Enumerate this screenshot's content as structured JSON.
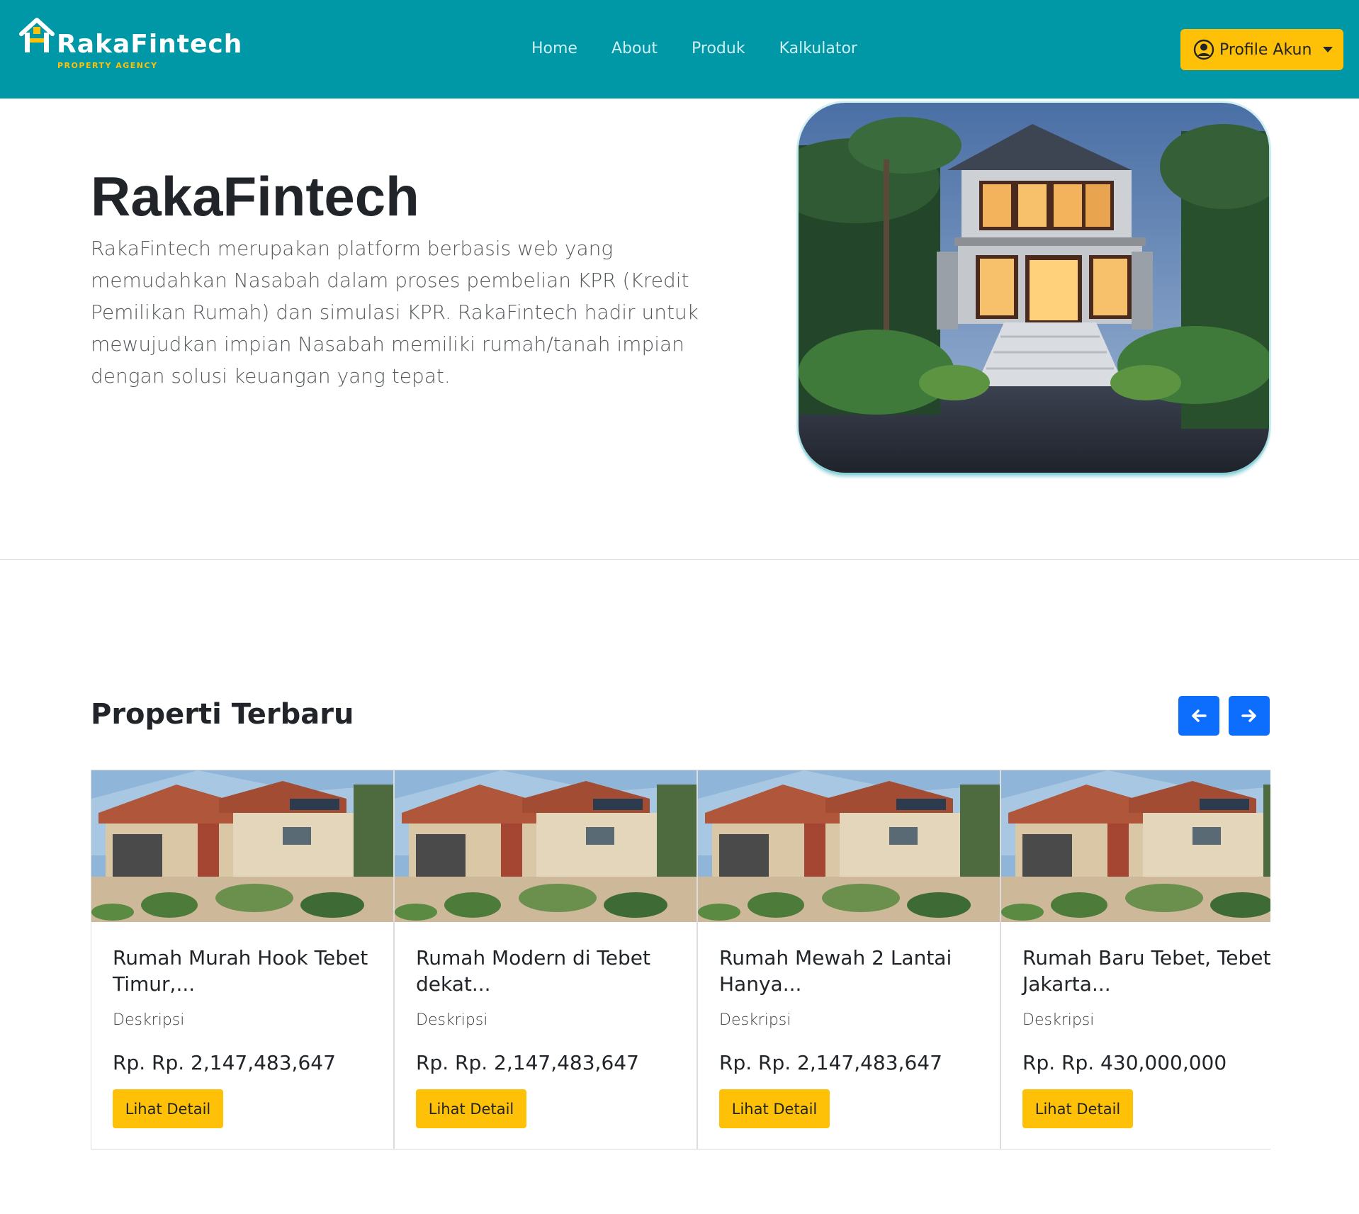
{
  "navbar": {
    "brand_name": "RakaFintech",
    "brand_tagline": "PROPERTY AGENCY",
    "links": [
      {
        "label": "Home"
      },
      {
        "label": "About"
      },
      {
        "label": "Produk"
      },
      {
        "label": "Kalkulator"
      }
    ],
    "profile_label": "Profile Akun"
  },
  "hero": {
    "title": "RakaFintech",
    "description": "RakaFintech merupakan platform berbasis web yang memudahkan Nasabah dalam proses pembelian KPR (Kredit Pemilikan Rumah) dan simulasi KPR. RakaFintech hadir untuk mewujudkan impian Nasabah memiliki rumah/tanah impian dengan solusi keuangan yang tepat."
  },
  "properti": {
    "section_title": "Properti Terbaru",
    "cards": [
      {
        "title": "Rumah Murah Hook Tebet Timur,...",
        "desc": "Deskripsi",
        "price": "Rp. Rp. 2,147,483,647",
        "button": "Lihat Detail"
      },
      {
        "title": "Rumah Modern di Tebet dekat...",
        "desc": "Deskripsi",
        "price": "Rp. Rp. 2,147,483,647",
        "button": "Lihat Detail"
      },
      {
        "title": "Rumah Mewah 2 Lantai Hanya...",
        "desc": "Deskripsi",
        "price": "Rp. Rp. 2,147,483,647",
        "button": "Lihat Detail"
      },
      {
        "title": "Rumah Baru Tebet, Tebet, Jakarta...",
        "desc": "Deskripsi",
        "price": "Rp. Rp. 430,000,000",
        "button": "Lihat Detail"
      }
    ]
  },
  "colors": {
    "navbar_bg": "#0097a7",
    "accent_yellow": "#ffc107",
    "arrow_blue": "#0d6efd"
  },
  "icons": {
    "brand": "house-logo-icon",
    "profile": "user-circle-icon",
    "prev": "arrow-left-icon",
    "next": "arrow-right-icon"
  }
}
